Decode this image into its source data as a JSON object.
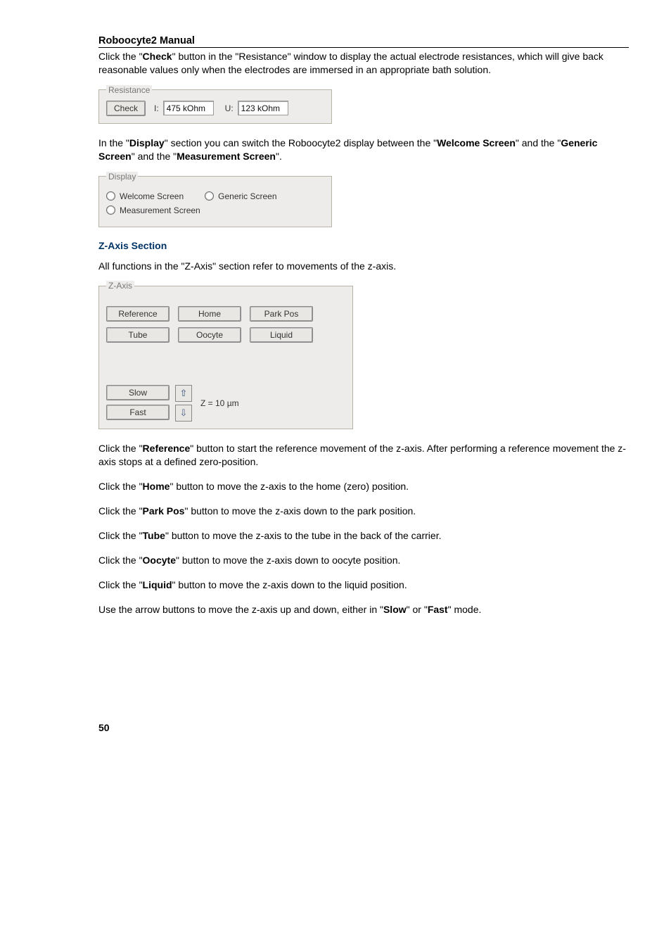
{
  "doc_title": "Roboocyte2  Manual",
  "intro_para": {
    "pre": "Click the \"",
    "btn": "Check",
    "post": "\" button in the \"Resistance\" window to display the actual electrode resistances, which will give back reasonable values only when the electrodes are immersed in an appropriate bath solution."
  },
  "resistance": {
    "legend": "Resistance",
    "check_label": "Check",
    "i_label": "I:",
    "i_value": "475 kOhm",
    "u_label": "U:",
    "u_value": "123 kOhm"
  },
  "display_para": {
    "a": "In the \"",
    "b": "Display",
    "c": "\" section you can switch the Roboocyte2 display between the \"",
    "d": "Welcome Screen",
    "e": "\" and the \"",
    "f": "Generic Screen",
    "g": "\" and the \"",
    "h": "Measurement Screen",
    "i": "\"."
  },
  "display_box": {
    "legend": "Display",
    "opt1": "Welcome Screen",
    "opt2": "Generic Screen",
    "opt3": "Measurement Screen"
  },
  "zaxis_head": "Z-Axis Section",
  "zaxis_intro": "All functions in the \"Z-Axis\" section refer to movements of the z-axis.",
  "zaxis_box": {
    "legend": "Z-Axis",
    "btn_reference": "Reference",
    "btn_home": "Home",
    "btn_parkpos": "Park Pos",
    "btn_tube": "Tube",
    "btn_oocyte": "Oocyte",
    "btn_liquid": "Liquid",
    "btn_slow": "Slow",
    "btn_fast": "Fast",
    "z_label": "Z = 10 µm"
  },
  "post_paras": [
    {
      "a": "Click the \"",
      "b": "Reference",
      "c": "\" button to start the reference movement of the z-axis. After performing a reference movement the z-axis stops at a defined zero-position."
    },
    {
      "a": "Click the \"",
      "b": "Home",
      "c": "\" button to move the z-axis to the home (zero) position."
    },
    {
      "a": "Click the \"",
      "b": "Park Pos",
      "c": "\" button to move the z-axis down to the park position."
    },
    {
      "a": "Click the \"",
      "b": "Tube",
      "c": "\" button to move the z-axis to the tube in the back of the carrier."
    },
    {
      "a": "Click the \"",
      "b": "Oocyte",
      "c": "\" button to move the z-axis down to oocyte position."
    },
    {
      "a": "Click the \"",
      "b": "Liquid",
      "c": "\" button to move the z-axis down to the liquid position."
    }
  ],
  "arrow_para": {
    "a": "Use the arrow buttons to move the z-axis up and down, either in \"",
    "b": "Slow",
    "c": "\" or \"",
    "d": "Fast",
    "e": "\" mode."
  },
  "page_number": "50"
}
